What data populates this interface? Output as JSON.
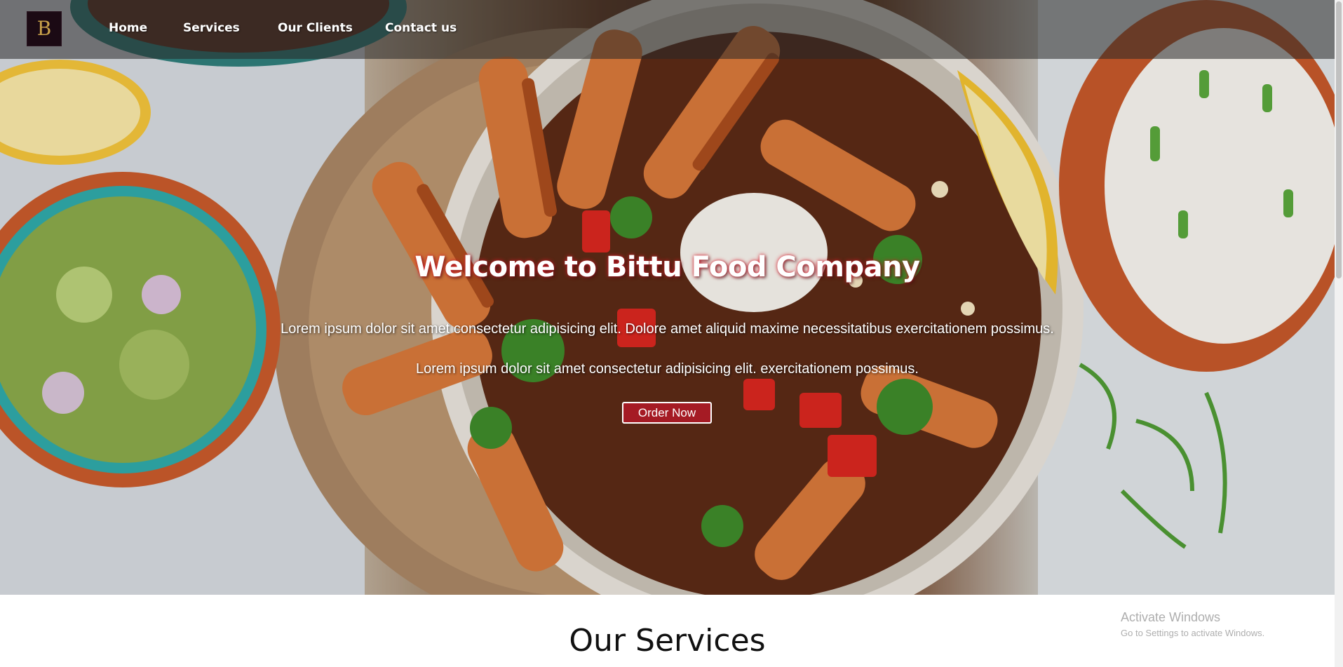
{
  "navbar": {
    "logo_text": "B",
    "items": [
      {
        "label": "Home"
      },
      {
        "label": "Services"
      },
      {
        "label": "Our Clients"
      },
      {
        "label": "Contact us"
      }
    ]
  },
  "hero": {
    "title": "Welcome to Bittu Food Company",
    "text_1": "Lorem ipsum dolor sit amet consectetur adipisicing elit. Dolore amet aliquid maxime necessitatibus exercitationem possimus.",
    "text_2": "Lorem ipsum dolor sit amet consectetur adipisicing elit. exercitationem possimus.",
    "button_label": "Order Now"
  },
  "services": {
    "title": "Our Services"
  },
  "watermark": {
    "line1": "Activate Windows",
    "line2": "Go to Settings to activate Windows."
  },
  "colors": {
    "navbar_bg": "rgba(40,40,40,0.55)",
    "button_bg": "#a51b24",
    "title_glow": "#e21a2b"
  }
}
